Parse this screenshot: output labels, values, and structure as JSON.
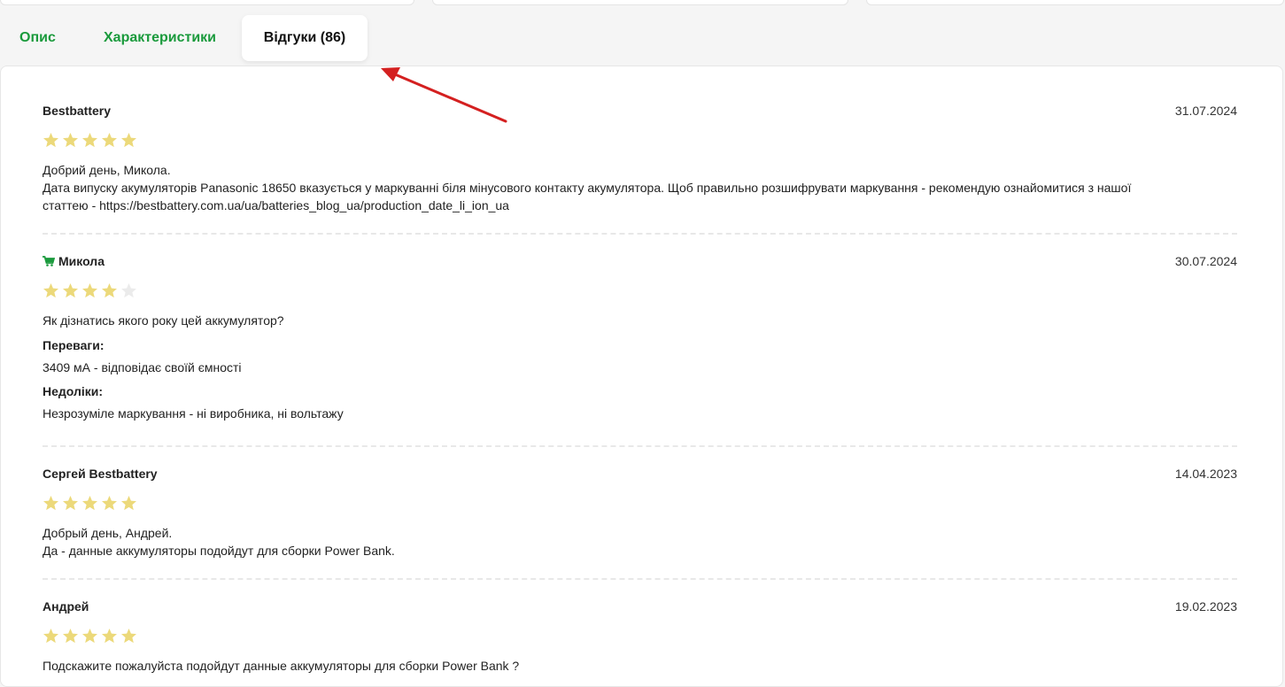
{
  "tabs": [
    {
      "label": "Опис",
      "active": false
    },
    {
      "label": "Характеристики",
      "active": false
    },
    {
      "label": "Відгуки (86)",
      "active": true
    }
  ],
  "colors": {
    "accent_green": "#1a9a3c",
    "star_filled": "#ecd97a",
    "star_empty": "#ebebeb",
    "arrow": "#d42020"
  },
  "reviews": [
    {
      "author": "Bestbattery",
      "buyer_icon": "",
      "date": "31.07.2024",
      "rating": 5,
      "text_lines": [
        "Добрий день, Микола.",
        "Дата випуску акумуляторів Panasonic 18650 вказується у маркуванні біля мінусового контакту акумулятора. Щоб правильно розшифрувати маркування - рекомендую ознайомитися з нашої",
        "статтею - https://bestbattery.com.ua/ua/batteries_blog_ua/production_date_li_ion_ua"
      ]
    },
    {
      "author": "Микола",
      "buyer_icon": "cart-icon",
      "date": "30.07.2024",
      "rating": 4,
      "text_lines": [
        "Як дізнатись якого року цей аккумулятор?"
      ],
      "pros_label": "Переваги:",
      "pros": "3409 мА - відповідає своїй ємності",
      "cons_label": "Недоліки:",
      "cons": "Незрозуміле маркування - ні виробника, ні вольтажу"
    },
    {
      "author": "Сергей Bestbattery",
      "buyer_icon": "",
      "date": "14.04.2023",
      "rating": 5,
      "text_lines": [
        "Добрый день, Андрей.",
        "Да - данные аккумуляторы подойдут для сборки Power Bank."
      ]
    },
    {
      "author": "Андрей",
      "buyer_icon": "",
      "date": "19.02.2023",
      "rating": 5,
      "text_lines": [
        "Подскажите пожалуйста подойдут данные аккумуляторы для сборки Power Bank ?"
      ]
    }
  ]
}
